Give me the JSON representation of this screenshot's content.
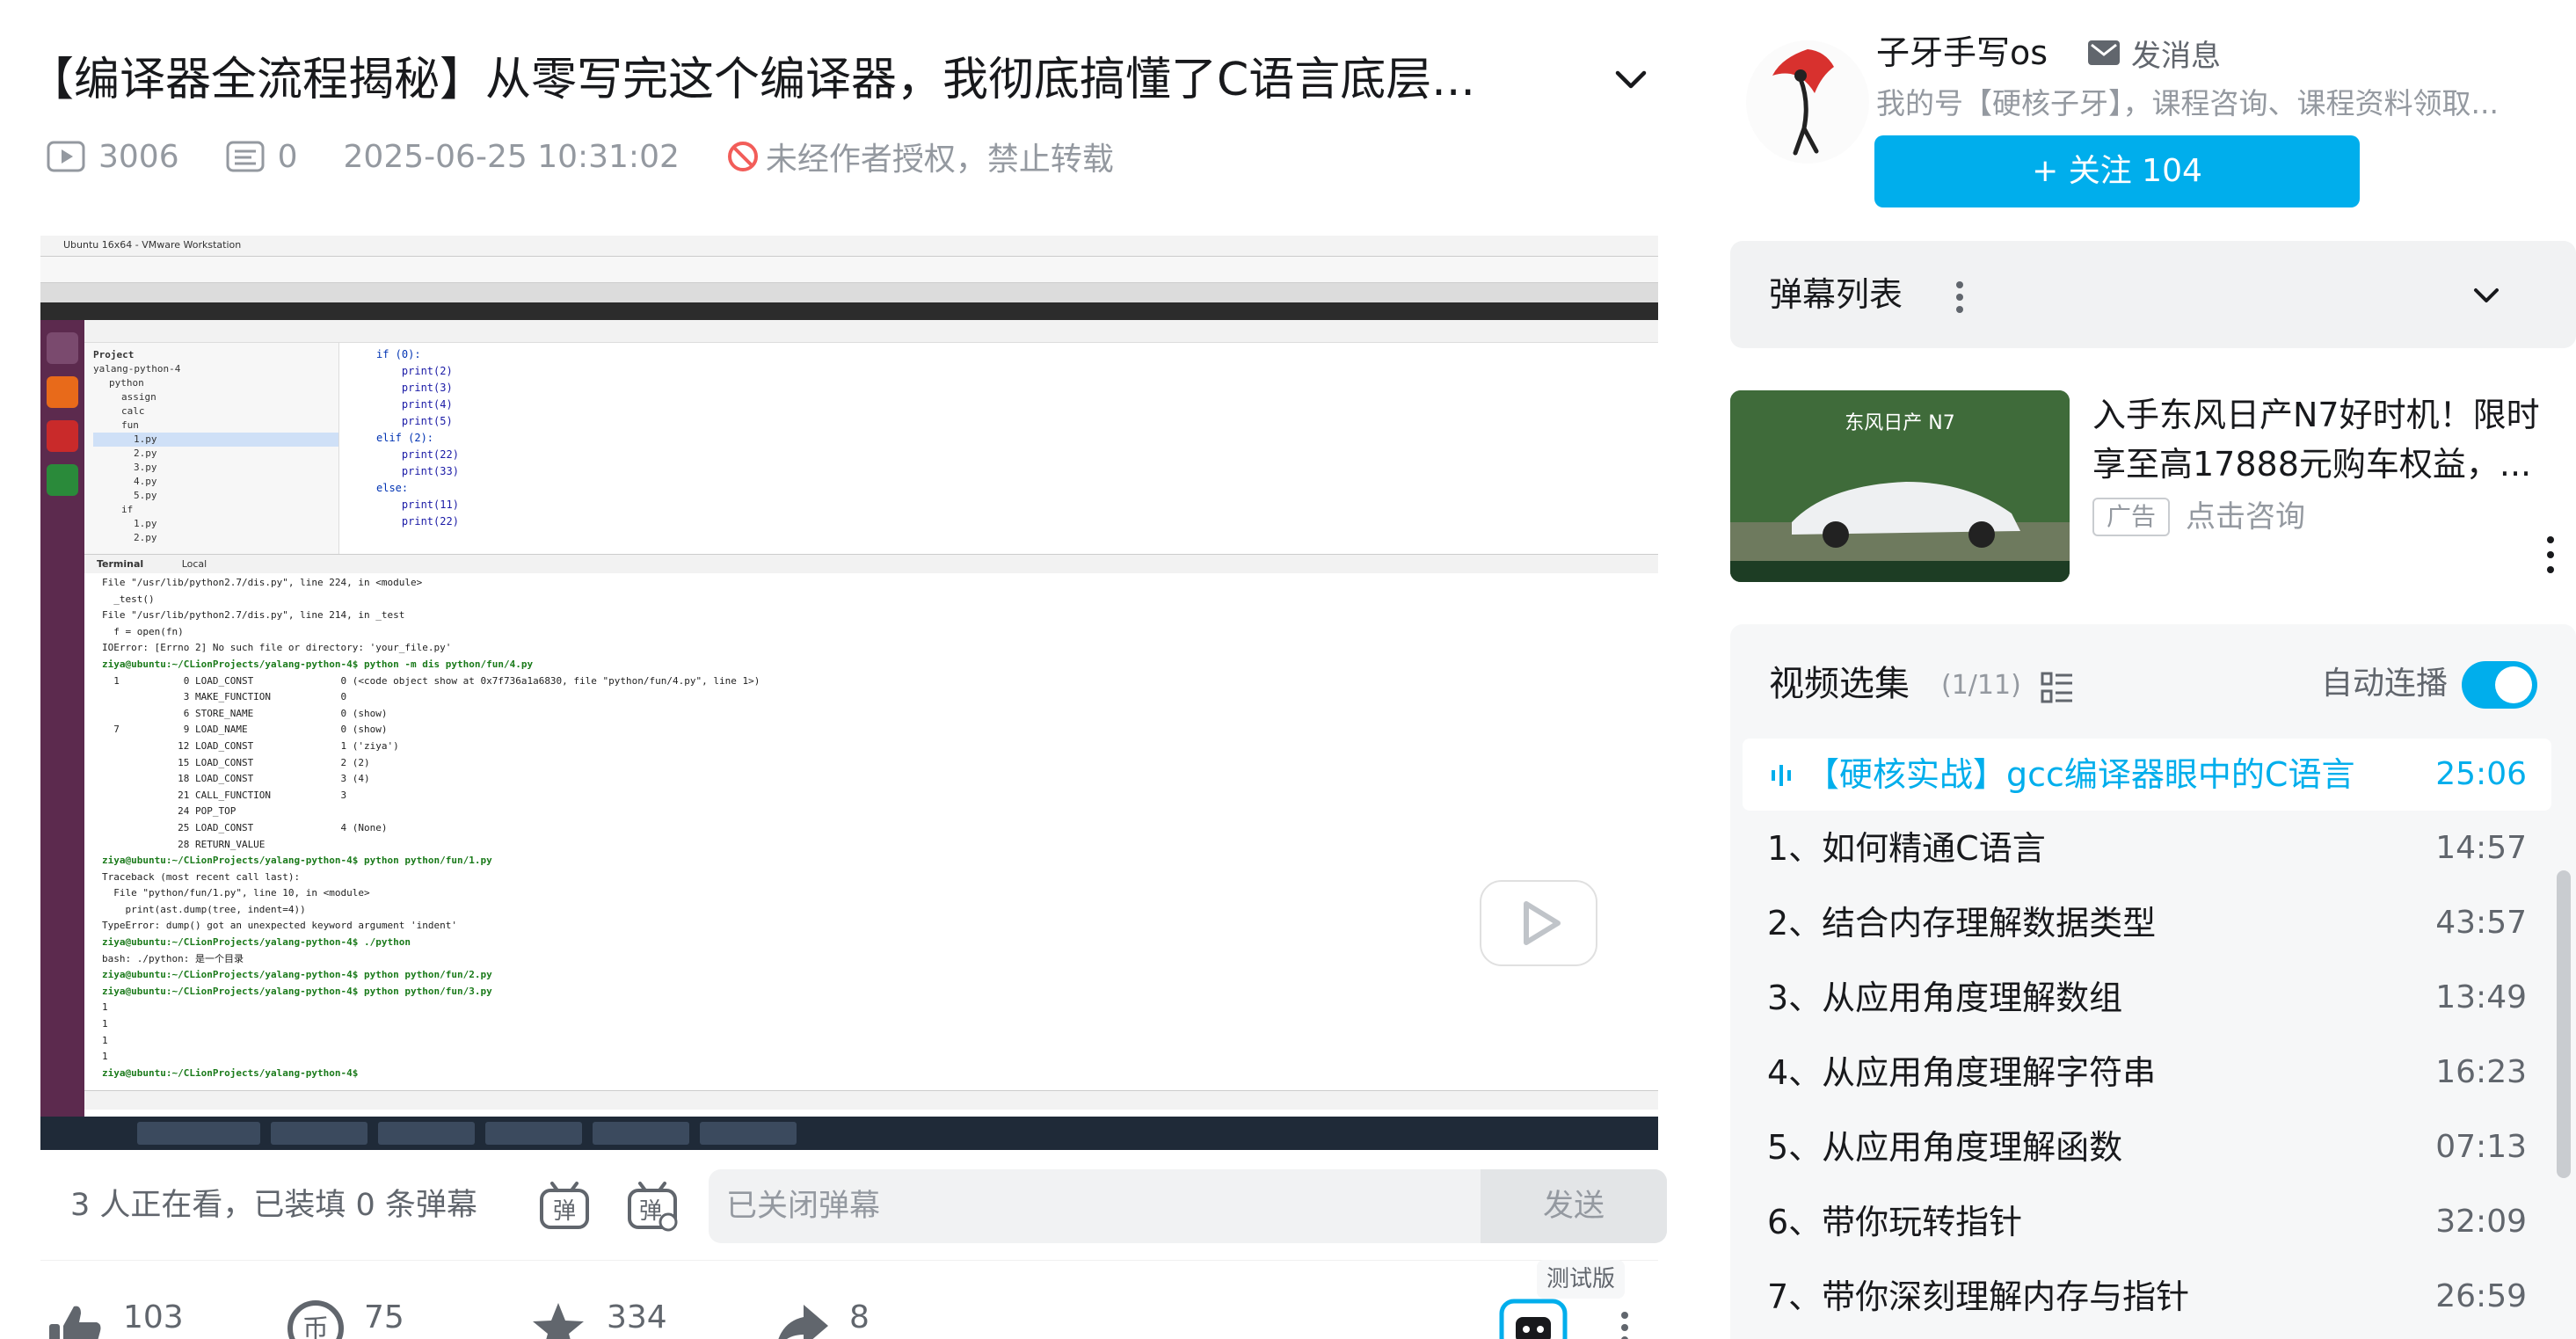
{
  "video": {
    "title": "【编译器全流程揭秘】从零写完这个编译器，我彻底搞懂了C语言底层...",
    "views": "3006",
    "danmaku_count": "0",
    "date": "2025-06-25 10:31:02",
    "copyright": "未经作者授权，禁止转载"
  },
  "player_screen": {
    "vm_title": "Ubuntu 16x64 - VMware Workstation",
    "project_label": "Project",
    "project_root": "yalang-python-4",
    "tree": [
      "python",
      "assign",
      "calc",
      "fun",
      "1.py",
      "2.py",
      "3.py",
      "4.py",
      "5.py",
      "if",
      "1.py",
      "2.py"
    ],
    "editor_lines": [
      "if (0):",
      "    print(2)",
      "    print(3)",
      "    print(4)",
      "    print(5)",
      "elif (2):",
      "    print(22)",
      "    print(33)",
      "else:",
      "    print(11)",
      "    print(22)"
    ],
    "terminal_tab": "Terminal",
    "terminal_local": "Local",
    "terminal_lines": [
      "File \"/usr/lib/python2.7/dis.py\", line 224, in <module>",
      "  _test()",
      "File \"/usr/lib/python2.7/dis.py\", line 214, in _test",
      "  f = open(fn)",
      "IOError: [Errno 2] No such file or directory: 'your_file.py'",
      "ziya@ubuntu:~/CLionProjects/yalang-python-4$ python -m dis python/fun/4.py",
      "  1           0 LOAD_CONST               0 (<code object show at 0x7f736a1a6830, file \"python/fun/4.py\", line 1>)",
      "              3 MAKE_FUNCTION            0",
      "              6 STORE_NAME               0 (show)",
      "",
      "  7           9 LOAD_NAME                0 (show)",
      "             12 LOAD_CONST               1 ('ziya')",
      "             15 LOAD_CONST               2 (2)",
      "             18 LOAD_CONST               3 (4)",
      "             21 CALL_FUNCTION            3",
      "             24 POP_TOP",
      "             25 LOAD_CONST               4 (None)",
      "             28 RETURN_VALUE",
      "ziya@ubuntu:~/CLionProjects/yalang-python-4$ python python/fun/1.py",
      "Traceback (most recent call last):",
      "  File \"python/fun/1.py\", line 10, in <module>",
      "    print(ast.dump(tree, indent=4))",
      "TypeError: dump() got an unexpected keyword argument 'indent'",
      "ziya@ubuntu:~/CLionProjects/yalang-python-4$ ./python",
      "bash: ./python: 是一个目录",
      "ziya@ubuntu:~/CLionProjects/yalang-python-4$ python python/fun/2.py",
      "ziya@ubuntu:~/CLionProjects/yalang-python-4$ python python/fun/3.py",
      "1",
      "1",
      "1",
      "1",
      "ziya@ubuntu:~/CLionProjects/yalang-python-4$"
    ]
  },
  "danmaku_bar": {
    "watching": "3 人正在看，已装填 0 条弹幕",
    "placeholder": "已关闭弹幕",
    "send": "发送",
    "test_badge": "测试版"
  },
  "actions": {
    "like": "103",
    "coin": "75",
    "favorite": "334",
    "share": "8"
  },
  "uploader": {
    "name": "子牙手写os",
    "message": "发消息",
    "desc": "我的号【硬核子牙】，课程咨询、课程资料领取...",
    "follow": "+ 关注 104"
  },
  "danmaku_list": {
    "label": "弹幕列表"
  },
  "ad": {
    "line1": "入手东风日产N7好时机！限时",
    "line2": "享至高17888元购车权益，...",
    "tag": "广告",
    "cta": "点击咨询",
    "image_brand": "东风日产 N7"
  },
  "collection": {
    "title": "视频选集",
    "count": "(1/11)",
    "autoplay": "自动连播",
    "episodes": [
      {
        "title": "【硬核实战】gcc编译器眼中的C语言",
        "duration": "25:06",
        "active": true
      },
      {
        "title": "1、如何精通C语言",
        "duration": "14:57"
      },
      {
        "title": "2、结合内存理解数据类型",
        "duration": "43:57"
      },
      {
        "title": "3、从应用角度理解数组",
        "duration": "13:49"
      },
      {
        "title": "4、从应用角度理解字符串",
        "duration": "16:23"
      },
      {
        "title": "5、从应用角度理解函数",
        "duration": "07:13"
      },
      {
        "title": "6、带你玩转指针",
        "duration": "32:09"
      },
      {
        "title": "7、带你深刻理解内存与指针",
        "duration": "26:59"
      }
    ]
  },
  "colors": {
    "accent": "#00aeec",
    "text": "#18191c",
    "muted": "#9499a0"
  }
}
